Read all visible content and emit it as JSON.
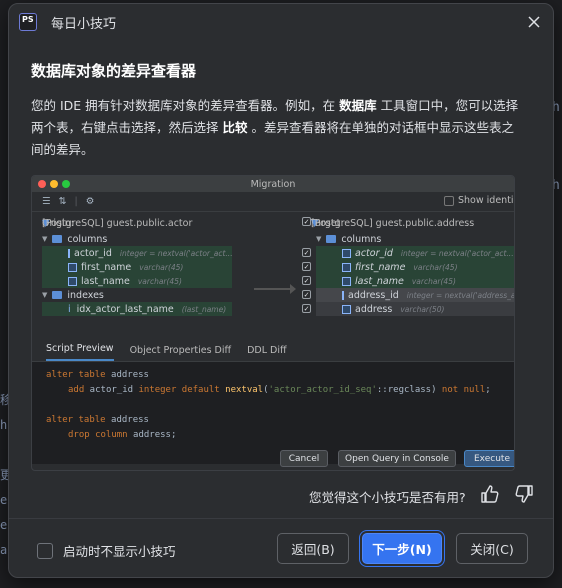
{
  "window": {
    "app_icon_text": "PS",
    "title": "每日小技巧"
  },
  "tip": {
    "heading": "数据库对象的差异查看器",
    "desc_part1": "您的 IDE 拥有针对数据库对象的差异查看器。例如，在 ",
    "desc_bold1": "数据库",
    "desc_part2": " 工具窗口中，您可以选择两个表，右键点击选择，然后选择 ",
    "desc_bold2": "比较",
    "desc_part3": " 。差异查看器将在单独的对话框中显示这些表之间的差异。"
  },
  "preview": {
    "window_title": "Migration",
    "show_identical": "Show identical",
    "origin_label": "Origin:",
    "origin_value": "[PostgreSQL] guest.public.actor",
    "target_label": "Target:",
    "target_value": "[PostgreSQL] guest.public.address",
    "left_tree": [
      {
        "name": "columns",
        "detail": ""
      },
      {
        "name": "actor_id",
        "detail": "integer = nextval('actor_act..."
      },
      {
        "name": "first_name",
        "detail": "varchar(45)"
      },
      {
        "name": "last_name",
        "detail": "varchar(45)"
      },
      {
        "name": "indexes",
        "detail": ""
      },
      {
        "name": "idx_actor_last_name",
        "detail": "(last_name)"
      }
    ],
    "right_tree": [
      {
        "name": "columns",
        "detail": ""
      },
      {
        "name": "actor_id",
        "detail": "integer = nextval('actor_act..."
      },
      {
        "name": "first_name",
        "detail": "varchar(45)"
      },
      {
        "name": "last_name",
        "detail": "varchar(45)"
      },
      {
        "name": "address_id",
        "detail": "integer = nextval('address_a..."
      },
      {
        "name": "address",
        "detail": "varchar(50)"
      }
    ],
    "tabs": [
      "Script Preview",
      "Object Properties Diff",
      "DDL Diff"
    ],
    "code": {
      "l1_kw": "alter table",
      "l1_plain": " address",
      "l2_kw1": "add",
      "l2_plain1": " actor_id ",
      "l2_kw2": "integer default",
      "l2_fn": " nextval",
      "l2_plain2": "(",
      "l2_str": "'actor_actor_id_seq'",
      "l2_plain3": "::regclass) ",
      "l2_kw3": "not null",
      "l2_plain4": ";",
      "l3_kw": "alter table",
      "l3_plain": " address",
      "l4_kw": "drop column",
      "l4_plain": " address;"
    },
    "buttons": {
      "cancel": "Cancel",
      "open_console": "Open Query in Console",
      "execute": "Execute"
    }
  },
  "feedback": {
    "question": "您觉得这个小技巧是否有用?"
  },
  "footer": {
    "dont_show_label": "启动时不显示小技巧",
    "back_label": "返回(B)",
    "next_label": "下一步(N)",
    "close_label": "关闭(C)"
  },
  "background": {
    "left_chars": [
      "移",
      "h",
      "",
      "更",
      "e",
      "e",
      "a"
    ],
    "right_chars": [
      "h",
      "",
      "",
      "h"
    ]
  }
}
